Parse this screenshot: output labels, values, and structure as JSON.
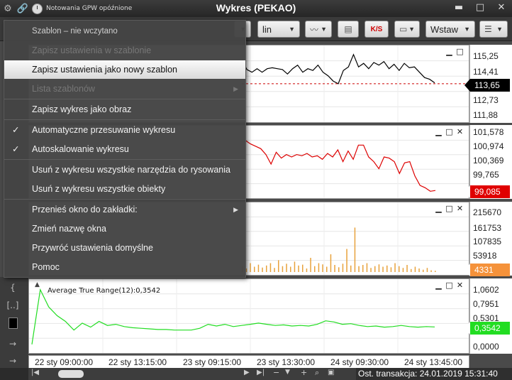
{
  "window": {
    "title": "Wykres (PEKAO)",
    "notice": "Notowania GPW opóźnione",
    "icons": [
      "gear-icon",
      "link-icon",
      "clock-icon"
    ],
    "controls": [
      "minimize",
      "maximize",
      "close"
    ]
  },
  "toolbar": {
    "scale": "lin",
    "ks_label": "K/S",
    "insert_label": "Wstaw"
  },
  "menu": {
    "items": [
      {
        "label": "Szablon – nie wczytano",
        "kind": "header"
      },
      {
        "label": "Zapisz ustawienia w szablonie",
        "kind": "disabled"
      },
      {
        "label": "Zapisz ustawienia jako nowy szablon",
        "kind": "highlight"
      },
      {
        "label": "Lista szablonów",
        "kind": "disabled",
        "submenu": true
      },
      {
        "label": "Zapisz wykres jako obraz"
      },
      {
        "label": "Automatyczne przesuwanie wykresu",
        "checked": true
      },
      {
        "label": "Autoskalowanie wykresu",
        "checked": true
      },
      {
        "label": "Usuń z wykresu wszystkie narzędzia do rysowania"
      },
      {
        "label": "Usuń z wykresu wszystkie obiekty"
      },
      {
        "label": "Przenieś okno do zakładki:",
        "submenu": true
      },
      {
        "label": "Zmień nazwę okna"
      },
      {
        "label": "Przywróć ustawienia domyślne"
      },
      {
        "label": "Pomoc"
      }
    ]
  },
  "panels": {
    "price": {
      "ticks": [
        "115,25",
        "114,41",
        "113,65",
        "112,73",
        "111,88"
      ],
      "last": "113,65",
      "color": "#000000",
      "series": [
        115.0,
        114.45,
        114.3,
        114.5,
        114.3,
        114.5,
        114.55,
        114.5,
        114.45,
        114.2,
        114.5,
        114.7,
        114.3,
        114.5,
        114.4,
        114.7,
        114.3,
        114.1,
        113.8,
        113.65,
        114.4,
        114.6,
        115.3,
        114.6,
        114.8,
        114.5,
        114.85,
        114.7,
        114.9,
        114.5,
        114.75,
        114.4,
        114.8,
        114.55,
        114.6,
        114.3,
        114.0,
        113.9,
        113.7
      ],
      "ref": 113.65
    },
    "indicator": {
      "ticks": [
        "101,578",
        "100,974",
        "100,369",
        "99,765"
      ],
      "last": "99,085",
      "color": "#cc0000",
      "series": [
        101.2,
        101.05,
        100.95,
        100.85,
        100.6,
        100.2,
        100.7,
        100.45,
        100.6,
        100.5,
        100.6,
        100.55,
        100.65,
        100.5,
        100.55,
        100.4,
        100.65,
        100.5,
        100.8,
        100.3,
        100.75,
        100.4,
        101.0,
        101.0,
        100.5,
        100.3,
        100.0,
        100.5,
        100.45,
        100.3,
        99.8,
        100.25,
        100.3,
        99.7,
        99.3,
        99.2,
        99.05,
        99.085
      ]
    },
    "volume": {
      "ticks": [
        "215670",
        "161753",
        "107835",
        "53918"
      ],
      "last": "4331",
      "color": "#ff9933",
      "bars": [
        20000,
        12000,
        30000,
        18000,
        25000,
        15000,
        22000,
        30000,
        14000,
        40000,
        20000,
        28000,
        18000,
        35000,
        22000,
        25000,
        12000,
        48000,
        20000,
        30000,
        26000,
        18000,
        60000,
        24000,
        16000,
        28000,
        78000,
        22000,
        150000,
        20000,
        24000,
        30000,
        14000,
        20000,
        26000,
        18000,
        22000,
        16000,
        30000,
        20000,
        14000,
        24000,
        10000,
        18000,
        12000,
        8000,
        14000,
        6000,
        4331
      ]
    },
    "atr": {
      "label": "Average True Range(12):0,3542",
      "ticks": [
        "1,0602",
        "0,7951",
        "0,5301",
        "0,2651",
        "0,0000"
      ],
      "last": "0,3542",
      "color": "#00dd00",
      "series": [
        0.05,
        1.0,
        0.7,
        0.55,
        0.45,
        0.3,
        0.42,
        0.35,
        0.45,
        0.38,
        0.4,
        0.36,
        0.34,
        0.33,
        0.32,
        0.31,
        0.31,
        0.3,
        0.3,
        0.3,
        0.33,
        0.4,
        0.37,
        0.4,
        0.36,
        0.38,
        0.4,
        0.42,
        0.4,
        0.38,
        0.39,
        0.37,
        0.38,
        0.37,
        0.4,
        0.46,
        0.44,
        0.4,
        0.41,
        0.38,
        0.36,
        0.37,
        0.35,
        0.36,
        0.38,
        0.36,
        0.35,
        0.36,
        0.3542
      ]
    }
  },
  "time_axis": [
    "22 sty 09:00:00",
    "22 sty 13:15:00",
    "23 sty 09:15:00",
    "23 sty 13:30:00",
    "24 sty 09:30:00",
    "24 sty 13:45:00"
  ],
  "status": "Ost. transakcja: 24.01.2019 15:31:40"
}
